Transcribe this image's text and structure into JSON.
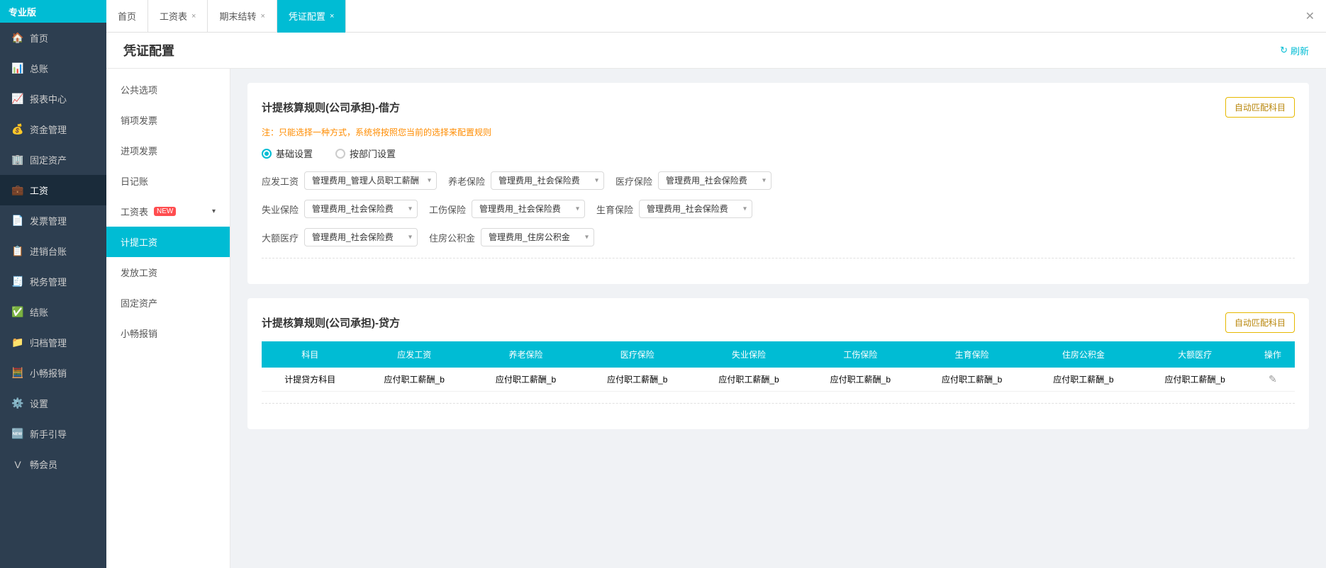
{
  "brand": "专业版",
  "sidebar": {
    "items": [
      {
        "label": "首页",
        "icon": "🏠",
        "active": false
      },
      {
        "label": "总账",
        "icon": "📊",
        "active": false
      },
      {
        "label": "报表中心",
        "icon": "📈",
        "active": false
      },
      {
        "label": "资金管理",
        "icon": "💰",
        "active": false
      },
      {
        "label": "固定资产",
        "icon": "🏢",
        "active": false
      },
      {
        "label": "工资",
        "icon": "💼",
        "active": true
      },
      {
        "label": "发票管理",
        "icon": "📄",
        "active": false
      },
      {
        "label": "进销台账",
        "icon": "📋",
        "active": false
      },
      {
        "label": "税务管理",
        "icon": "🧾",
        "active": false
      },
      {
        "label": "结账",
        "icon": "✅",
        "active": false
      },
      {
        "label": "归档管理",
        "icon": "📁",
        "active": false
      },
      {
        "label": "小畅报销",
        "icon": "🧮",
        "active": false
      },
      {
        "label": "设置",
        "icon": "⚙️",
        "active": false
      },
      {
        "label": "新手引导",
        "icon": "🆕",
        "active": false
      },
      {
        "label": "畅会员",
        "icon": "👑",
        "active": false
      }
    ]
  },
  "tabs": [
    {
      "label": "首页",
      "closable": false,
      "active": false
    },
    {
      "label": "工资表",
      "closable": true,
      "active": false
    },
    {
      "label": "期末结转",
      "closable": true,
      "active": false
    },
    {
      "label": "凭证配置",
      "closable": true,
      "active": true
    }
  ],
  "page_title": "凭证配置",
  "refresh_label": "刷新",
  "left_menu": {
    "items": [
      {
        "label": "公共选项",
        "active": false
      },
      {
        "label": "销项发票",
        "active": false
      },
      {
        "label": "进项发票",
        "active": false
      },
      {
        "label": "日记账",
        "active": false
      },
      {
        "label": "工资表",
        "active": false,
        "has_new": true,
        "expandable": true
      },
      {
        "label": "计提工资",
        "active": true
      },
      {
        "label": "发放工资",
        "active": false
      },
      {
        "label": "固定资产",
        "active": false
      },
      {
        "label": "小畅报销",
        "active": false
      }
    ]
  },
  "section1": {
    "title": "计提核算规则(公司承担)-借方",
    "notice": "注：只能选择一种方式，系统将按照您当前的选择来配置规则",
    "auto_match_label": "自动匹配科目",
    "radio_options": [
      {
        "label": "基础设置",
        "selected": true
      },
      {
        "label": "按部门设置",
        "selected": false
      }
    ],
    "rows": [
      [
        {
          "label": "应发工资",
          "value": "管理费用_管理人员职工薪酬"
        },
        {
          "label": "养老保险",
          "value": "管理费用_社会保险费"
        },
        {
          "label": "医疗保险",
          "value": "管理费用_社会保险费"
        }
      ],
      [
        {
          "label": "失业保险",
          "value": "管理费用_社会保险费"
        },
        {
          "label": "工伤保险",
          "value": "管理费用_社会保险费"
        },
        {
          "label": "生育保险",
          "value": "管理费用_社会保险费"
        }
      ],
      [
        {
          "label": "大额医疗",
          "value": "管理费用_社会保险费"
        },
        {
          "label": "住房公积金",
          "value": "管理费用_住房公积金"
        }
      ]
    ]
  },
  "section2": {
    "title": "计提核算规则(公司承担)-贷方",
    "auto_match_label": "自动匹配科目",
    "table": {
      "headers": [
        "科目",
        "应发工资",
        "养老保险",
        "医疗保险",
        "失业保险",
        "工伤保险",
        "生育保险",
        "住房公积金",
        "大额医疗",
        "操作"
      ],
      "rows": [
        {
          "col0": "计提贷方科目",
          "col1": "应付职工薪酬_b",
          "col2": "应付职工薪酬_b",
          "col3": "应付职工薪酬_b",
          "col4": "应付职工薪酬_b",
          "col5": "应付职工薪酬_b",
          "col6": "应付职工薪酬_b",
          "col7": "应付职工薪酬_b",
          "col8": "应付职工薪酬_b",
          "col9": "✎"
        }
      ]
    }
  }
}
